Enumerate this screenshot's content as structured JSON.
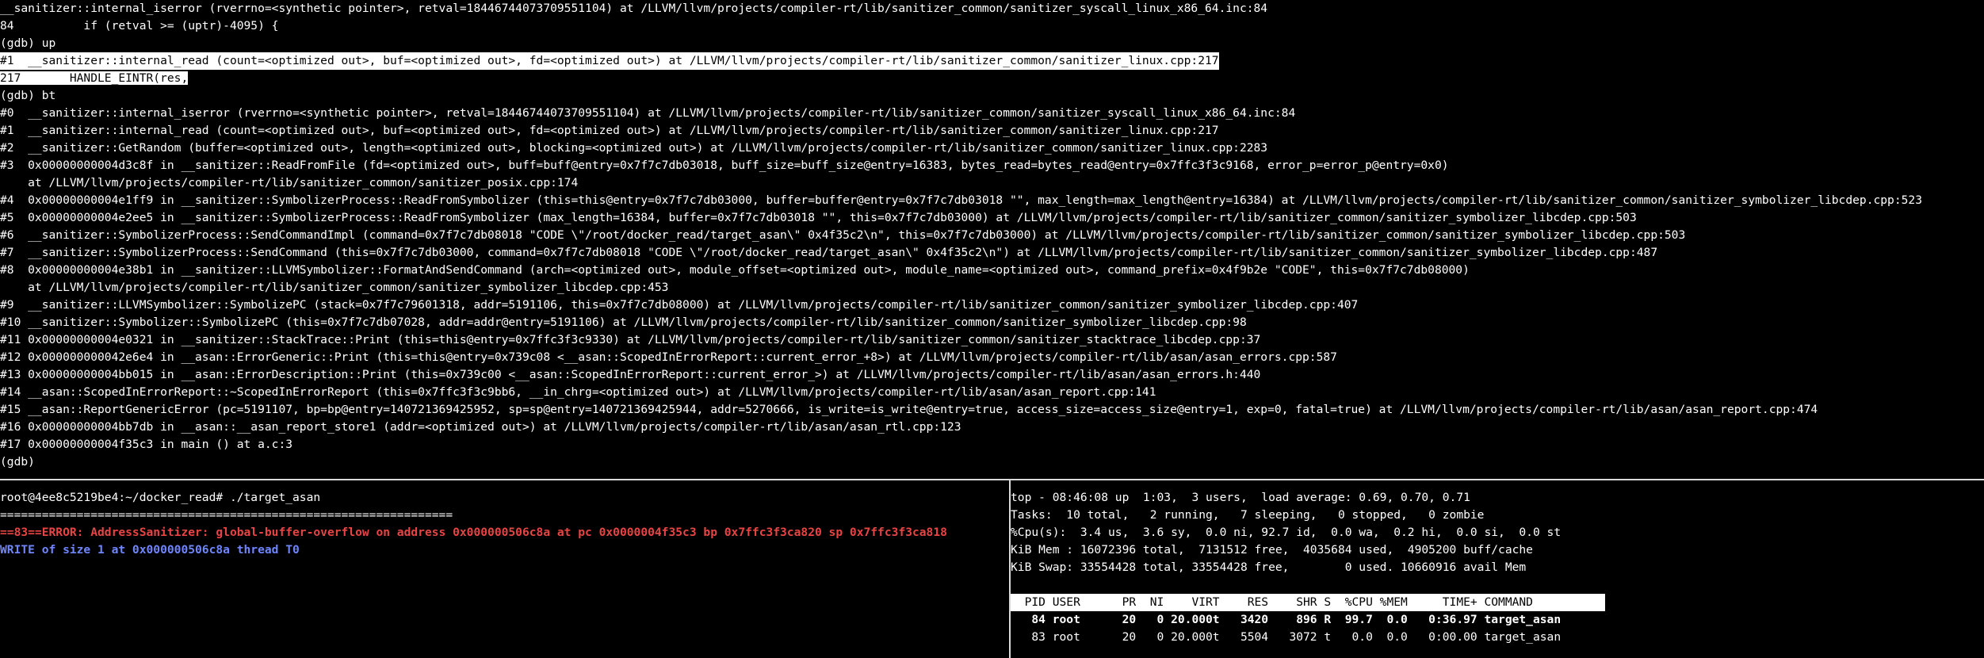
{
  "colors": {
    "background": "#000000",
    "foreground": "#ffffff",
    "divider": "#d9d9d9",
    "error_red": "#e84444",
    "info_blue": "#6f86ff",
    "selection_bg": "#ffffff"
  },
  "gdb": {
    "lines": [
      "__sanitizer::internal_iserror (rverrno=<synthetic pointer>, retval=18446744073709551104) at /LLVM/llvm/projects/compiler-rt/lib/sanitizer_common/sanitizer_syscall_linux_x86_64.inc:84",
      "84          if (retval >= (uptr)-4095) {",
      "(gdb) up",
      "#1  __sanitizer::internal_read (count=<optimized out>, buf=<optimized out>, fd=<optimized out>) at /LLVM/llvm/projects/compiler-rt/lib/sanitizer_common/sanitizer_linux.cpp:217",
      "217       HANDLE_EINTR(res,",
      "(gdb) bt",
      "#0  __sanitizer::internal_iserror (rverrno=<synthetic pointer>, retval=18446744073709551104) at /LLVM/llvm/projects/compiler-rt/lib/sanitizer_common/sanitizer_syscall_linux_x86_64.inc:84",
      "#1  __sanitizer::internal_read (count=<optimized out>, buf=<optimized out>, fd=<optimized out>) at /LLVM/llvm/projects/compiler-rt/lib/sanitizer_common/sanitizer_linux.cpp:217",
      "#2  __sanitizer::GetRandom (buffer=<optimized out>, length=<optimized out>, blocking=<optimized out>) at /LLVM/llvm/projects/compiler-rt/lib/sanitizer_common/sanitizer_linux.cpp:2283",
      "#3  0x00000000004d3c8f in __sanitizer::ReadFromFile (fd=<optimized out>, buff=buff@entry=0x7f7c7db03018, buff_size=buff_size@entry=16383, bytes_read=bytes_read@entry=0x7ffc3f3c9168, error_p=error_p@entry=0x0)",
      "    at /LLVM/llvm/projects/compiler-rt/lib/sanitizer_common/sanitizer_posix.cpp:174",
      "#4  0x00000000004e1ff9 in __sanitizer::SymbolizerProcess::ReadFromSymbolizer (this=this@entry=0x7f7c7db03000, buffer=buffer@entry=0x7f7c7db03018 \"\", max_length=max_length@entry=16384) at /LLVM/llvm/projects/compiler-rt/lib/sanitizer_common/sanitizer_symbolizer_libcdep.cpp:523",
      "#5  0x00000000004e2ee5 in __sanitizer::SymbolizerProcess::ReadFromSymbolizer (max_length=16384, buffer=0x7f7c7db03018 \"\", this=0x7f7c7db03000) at /LLVM/llvm/projects/compiler-rt/lib/sanitizer_common/sanitizer_symbolizer_libcdep.cpp:503",
      "#6  __sanitizer::SymbolizerProcess::SendCommandImpl (command=0x7f7c7db08018 \"CODE \\\"/root/docker_read/target_asan\\\" 0x4f35c2\\n\", this=0x7f7c7db03000) at /LLVM/llvm/projects/compiler-rt/lib/sanitizer_common/sanitizer_symbolizer_libcdep.cpp:503",
      "#7  __sanitizer::SymbolizerProcess::SendCommand (this=0x7f7c7db03000, command=0x7f7c7db08018 \"CODE \\\"/root/docker_read/target_asan\\\" 0x4f35c2\\n\") at /LLVM/llvm/projects/compiler-rt/lib/sanitizer_common/sanitizer_symbolizer_libcdep.cpp:487",
      "#8  0x00000000004e38b1 in __sanitizer::LLVMSymbolizer::FormatAndSendCommand (arch=<optimized out>, module_offset=<optimized out>, module_name=<optimized out>, command_prefix=0x4f9b2e \"CODE\", this=0x7f7c7db08000)",
      "    at /LLVM/llvm/projects/compiler-rt/lib/sanitizer_common/sanitizer_symbolizer_libcdep.cpp:453",
      "#9  __sanitizer::LLVMSymbolizer::SymbolizePC (stack=0x7f7c79601318, addr=5191106, this=0x7f7c7db08000) at /LLVM/llvm/projects/compiler-rt/lib/sanitizer_common/sanitizer_symbolizer_libcdep.cpp:407",
      "#10 __sanitizer::Symbolizer::SymbolizePC (this=0x7f7c7db07028, addr=addr@entry=5191106) at /LLVM/llvm/projects/compiler-rt/lib/sanitizer_common/sanitizer_symbolizer_libcdep.cpp:98",
      "#11 0x00000000004e0321 in __sanitizer::StackTrace::Print (this=this@entry=0x7ffc3f3c9330) at /LLVM/llvm/projects/compiler-rt/lib/sanitizer_common/sanitizer_stacktrace_libcdep.cpp:37",
      "#12 0x000000000042e6e4 in __asan::ErrorGeneric::Print (this=this@entry=0x739c08 <__asan::ScopedInErrorReport::current_error_+8>) at /LLVM/llvm/projects/compiler-rt/lib/asan/asan_errors.cpp:587",
      "#13 0x00000000004bb015 in __asan::ErrorDescription::Print (this=0x739c00 <__asan::ScopedInErrorReport::current_error_>) at /LLVM/llvm/projects/compiler-rt/lib/asan/asan_errors.h:440",
      "#14 __asan::ScopedInErrorReport::~ScopedInErrorReport (this=0x7ffc3f3c9bb6, __in_chrg=<optimized out>) at /LLVM/llvm/projects/compiler-rt/lib/asan/asan_report.cpp:141",
      "#15 __asan::ReportGenericError (pc=5191107, bp=bp@entry=140721369425952, sp=sp@entry=140721369425944, addr=5270666, is_write=is_write@entry=true, access_size=access_size@entry=1, exp=0, fatal=true) at /LLVM/llvm/projects/compiler-rt/lib/asan/asan_report.cpp:474",
      "#16 0x00000000004bb7db in __asan::__asan_report_store1 (addr=<optimized out>) at /LLVM/llvm/projects/compiler-rt/lib/asan/asan_rtl.cpp:123",
      "#17 0x00000000004f35c3 in main () at a.c:3",
      "(gdb) "
    ]
  },
  "shell": {
    "prompt_line": "root@4ee8c5219be4:~/docker_read# ./target_asan",
    "separator": "=================================================================",
    "error_line": "==83==ERROR: AddressSanitizer: global-buffer-overflow on address 0x000000506c8a at pc 0x0000004f35c3 bp 0x7ffc3f3ca820 sp 0x7ffc3f3ca818",
    "write_line": "WRITE of size 1 at 0x000000506c8a thread T0"
  },
  "top": {
    "summary": "top - 08:46:08 up  1:03,  3 users,  load average: 0.69, 0.70, 0.71",
    "tasks": "Tasks:  10 total,   2 running,   7 sleeping,   0 stopped,   0 zombie",
    "cpu": "%Cpu(s):  3.4 us,  3.6 sy,  0.0 ni, 92.7 id,  0.0 wa,  0.2 hi,  0.0 si,  0.0 st",
    "mem": "KiB Mem : 16072396 total,  7131512 free,  4035684 used,  4905200 buff/cache",
    "swap": "KiB Swap: 33554428 total, 33554428 free,        0 used. 10660916 avail Mem",
    "header": "  PID USER      PR  NI    VIRT    RES    SHR S  %CPU %MEM     TIME+ COMMAND",
    "processes": [
      {
        "text": "   84 root      20   0 20.000t   3420    896 R  99.7  0.0   0:36.97 target_asan",
        "bold": true
      },
      {
        "text": "   83 root      20   0 20.000t   5504   3072 t   0.0  0.0   0:00.00 target_asan",
        "bold": false
      }
    ]
  }
}
